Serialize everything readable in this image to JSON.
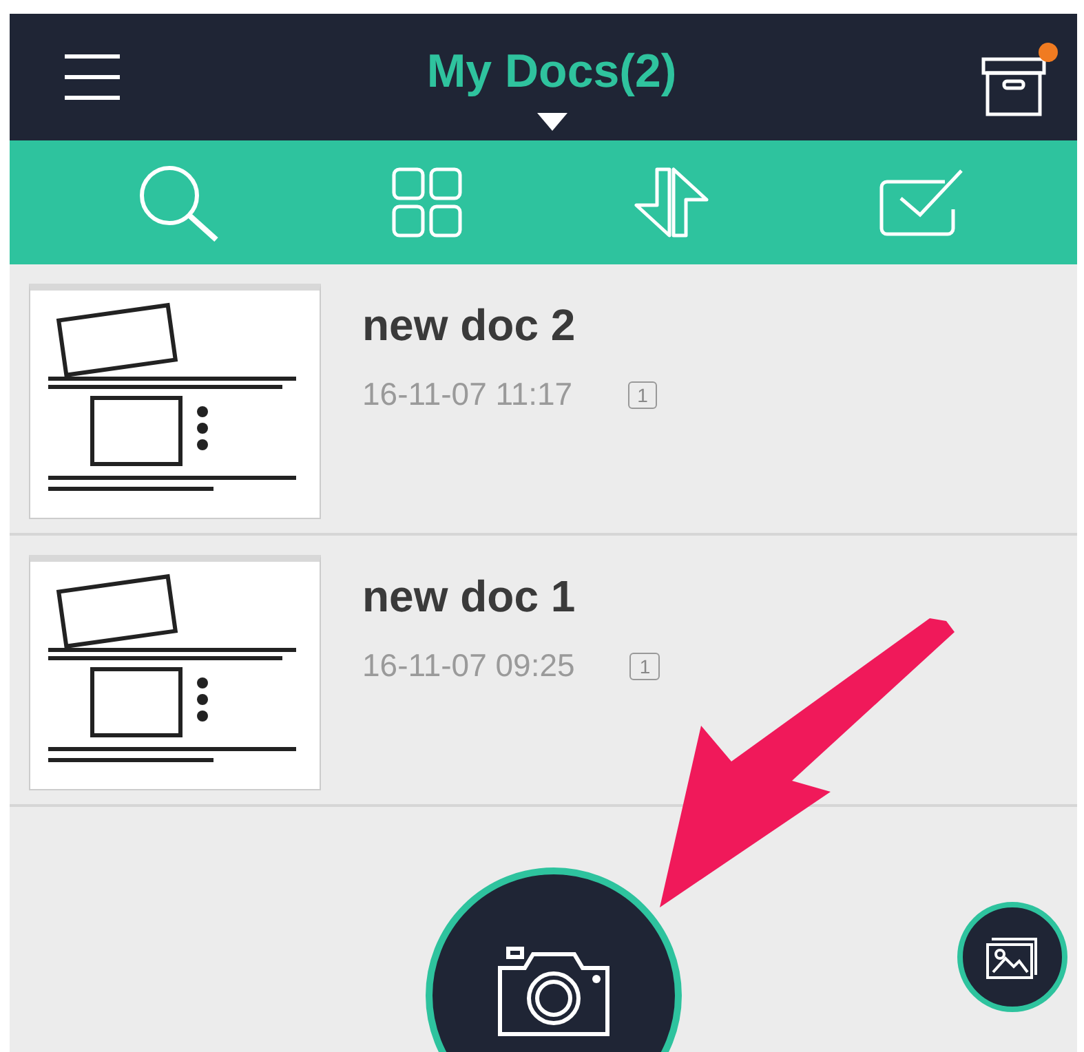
{
  "header": {
    "title": "My Docs(2)",
    "archive_has_badge": true
  },
  "docs": [
    {
      "name": "new doc 2",
      "date": "16-11-07 11:17",
      "pages": "1"
    },
    {
      "name": "new doc 1",
      "date": "16-11-07 09:25",
      "pages": "1"
    }
  ]
}
